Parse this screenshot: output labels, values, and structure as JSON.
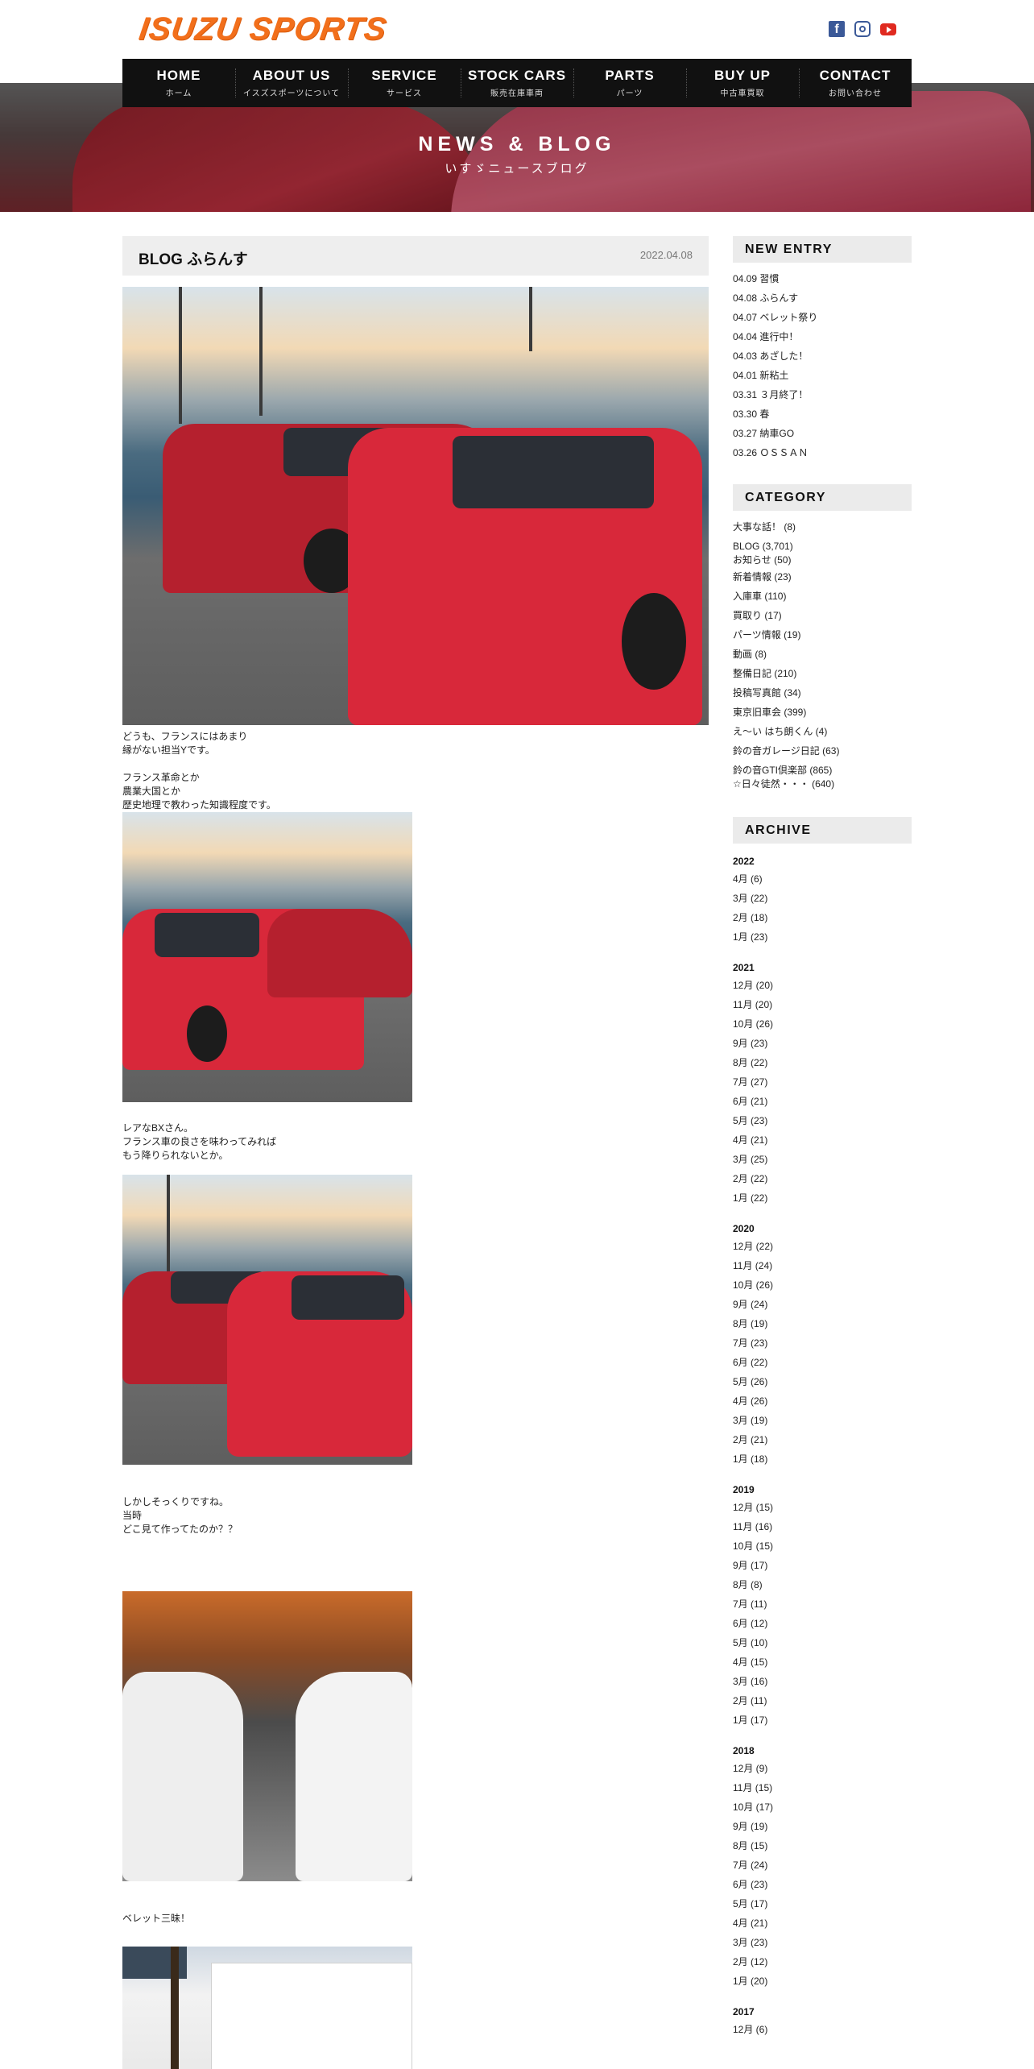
{
  "header": {
    "logo_text": "ISUZU SPORTS",
    "social": [
      {
        "name": "facebook-icon",
        "glyph": "f"
      },
      {
        "name": "instagram-icon",
        "glyph": ""
      },
      {
        "name": "youtube-icon",
        "glyph": ""
      }
    ]
  },
  "nav": [
    {
      "en": "HOME",
      "jp": "ホーム"
    },
    {
      "en": "ABOUT US",
      "jp": "イスズスポーツについて"
    },
    {
      "en": "SERVICE",
      "jp": "サービス"
    },
    {
      "en": "STOCK CARS",
      "jp": "販売在庫車両"
    },
    {
      "en": "PARTS",
      "jp": "パーツ"
    },
    {
      "en": "BUY UP",
      "jp": "中古車買取"
    },
    {
      "en": "CONTACT",
      "jp": "お問い合わせ"
    }
  ],
  "hero": {
    "title": "NEWS & BLOG",
    "subtitle": "いすゞニュースブログ"
  },
  "post": {
    "title": "BLOG ふらんす",
    "date": "2022.04.08",
    "paragraphs": [
      [
        "どうも、フランスにはあまり",
        "縁がない担当Yです。",
        "",
        "フランス革命とか",
        "農業大国とか",
        "歴史地理で教わった知識程度です。"
      ],
      [
        "レアなBXさん。",
        "フランス車の良さを味わってみれば",
        "もう降りられないとか。"
      ],
      [
        "しかしそっくりですね。",
        "当時",
        "どこ見て作ってたのか？？"
      ],
      [
        "ベレット三昧！"
      ]
    ]
  },
  "sidebar": {
    "new_entry_title": "NEW ENTRY",
    "new_entries": [
      "04.09 習慣",
      "04.08 ふらんす",
      "04.07 ベレット祭り",
      "04.04 進行中！",
      "04.03 あざした！",
      "04.01 新粘土",
      "03.31 ３月終了！",
      "03.30 春",
      "03.27 納車GO",
      "03.26 ＯＳＳＡＮ"
    ],
    "category_title": "CATEGORY",
    "categories": [
      "大事な話！ (8)",
      "BLOG (3,701)",
      "お知らせ (50)",
      "新着情報 (23)",
      "入庫車 (110)",
      "買取り (17)",
      "パーツ情報 (19)",
      "動画 (8)",
      "整備日記 (210)",
      "投稿写真館 (34)",
      "東京旧車会 (399)",
      "え～い はち朗くん (4)",
      "鈴の音ガレージ日記 (63)",
      "鈴の音GTI倶楽部 (865)",
      "☆日々徒然・・・ (640)"
    ],
    "archive_title": "ARCHIVE",
    "archive": [
      {
        "year": "2022",
        "months": [
          "4月 (6)",
          "3月 (22)",
          "2月 (18)",
          "1月 (23)"
        ]
      },
      {
        "year": "2021",
        "months": [
          "12月 (20)",
          "11月 (20)",
          "10月 (26)",
          "9月 (23)",
          "8月 (22)",
          "7月 (27)",
          "6月 (21)",
          "5月 (23)",
          "4月 (21)",
          "3月 (25)",
          "2月 (22)",
          "1月 (22)"
        ]
      },
      {
        "year": "2020",
        "months": [
          "12月 (22)",
          "11月 (24)",
          "10月 (26)",
          "9月 (24)",
          "8月 (19)",
          "7月 (23)",
          "6月 (22)",
          "5月 (26)",
          "4月 (26)",
          "3月 (19)",
          "2月 (21)",
          "1月 (18)"
        ]
      },
      {
        "year": "2019",
        "months": [
          "12月 (15)",
          "11月 (16)",
          "10月 (15)",
          "9月 (17)",
          "8月 (8)",
          "7月 (11)",
          "6月 (12)",
          "5月 (10)",
          "4月 (15)",
          "3月 (16)",
          "2月 (11)",
          "1月 (17)"
        ]
      },
      {
        "year": "2018",
        "months": [
          "12月 (9)",
          "11月 (15)",
          "10月 (17)",
          "9月 (19)",
          "8月 (15)",
          "7月 (24)",
          "6月 (23)",
          "5月 (17)",
          "4月 (21)",
          "3月 (23)",
          "2月 (12)",
          "1月 (20)"
        ]
      },
      {
        "year": "2017",
        "months": [
          "12月 (6)"
        ]
      }
    ]
  },
  "colors": {
    "logo_orange": "#f26f1b",
    "nav_bg": "#111111",
    "box_gray": "#eeeeee"
  }
}
